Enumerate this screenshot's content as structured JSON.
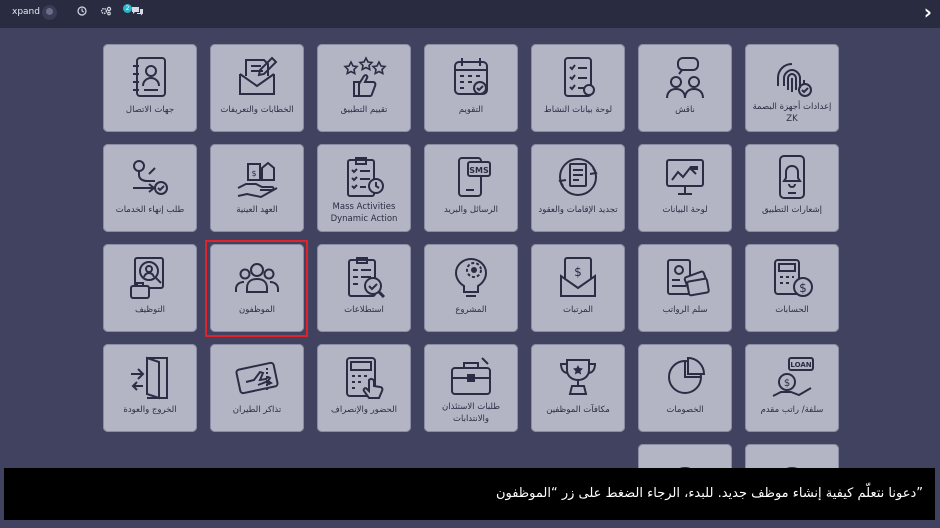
{
  "topbar": {
    "brand": "xpand",
    "notification_count": "2",
    "icons": [
      "user-avatar",
      "clock-icon",
      "settings-icon",
      "chat-icon",
      "chevron-right-icon"
    ]
  },
  "tiles": [
    {
      "label": "إعدادات أجهزة البصمة ZK",
      "icon": "fingerprint-icon"
    },
    {
      "label": "ناقش",
      "icon": "discussion-icon"
    },
    {
      "label": "لوحة بيانات النشاط",
      "icon": "checklist-icon"
    },
    {
      "label": "التقويم",
      "icon": "calendar-icon"
    },
    {
      "label": "تقييم التطبيق",
      "icon": "rating-icon"
    },
    {
      "label": "الخطابات والتعريفات",
      "icon": "letter-icon"
    },
    {
      "label": "جهات الاتصال",
      "icon": "contacts-icon"
    },
    {
      "label": "إشعارات التطبيق",
      "icon": "notification-icon"
    },
    {
      "label": "لوحة البيانات",
      "icon": "dashboard-icon"
    },
    {
      "label": "تجديد الإقامات والعقود",
      "icon": "renewal-icon"
    },
    {
      "label": "الرسائل والبريد",
      "icon": "sms-icon"
    },
    {
      "label": "Mass Activities Dynamic Action",
      "icon": "mass-activity-icon"
    },
    {
      "label": "العهد العينية",
      "icon": "assets-icon"
    },
    {
      "label": "طلب إنهاء الخدمات",
      "icon": "termination-icon"
    },
    {
      "label": "الحسابات",
      "icon": "accounting-icon"
    },
    {
      "label": "سلم الرواتب",
      "icon": "salary-scale-icon"
    },
    {
      "label": "المرتبات",
      "icon": "payroll-icon"
    },
    {
      "label": "المشروع",
      "icon": "project-icon"
    },
    {
      "label": "استطلاعات",
      "icon": "survey-icon"
    },
    {
      "label": "الموظفون",
      "icon": "employees-icon"
    },
    {
      "label": "التوظيف",
      "icon": "recruitment-icon"
    },
    {
      "label": "سلفة/ راتب مقدم",
      "icon": "loan-icon"
    },
    {
      "label": "الخصومات",
      "icon": "deductions-icon"
    },
    {
      "label": "مكافآت الموظفين",
      "icon": "rewards-icon"
    },
    {
      "label": "طلبات الاستئذان والانتدابات",
      "icon": "permission-icon"
    },
    {
      "label": "الحضور والإنصراف",
      "icon": "attendance-icon"
    },
    {
      "label": "تذاكر الطيران",
      "icon": "flight-ticket-icon"
    },
    {
      "label": "الخروج والعودة",
      "icon": "exit-return-icon"
    },
    {
      "label": "",
      "icon": "partial-tile-icon"
    },
    {
      "label": "",
      "icon": "partial-tile-icon"
    }
  ],
  "highlighted_tile": "الموظفون",
  "caption": "دعونا نتعلّم كيفية إنشاء موظف جديد. للبدء، الرجاء الضغط على زر “الموظفون”",
  "colors": {
    "background": "#404260",
    "tile": "#b4b5c4",
    "highlight": "#e0232a",
    "caption_bg": "#000000"
  }
}
